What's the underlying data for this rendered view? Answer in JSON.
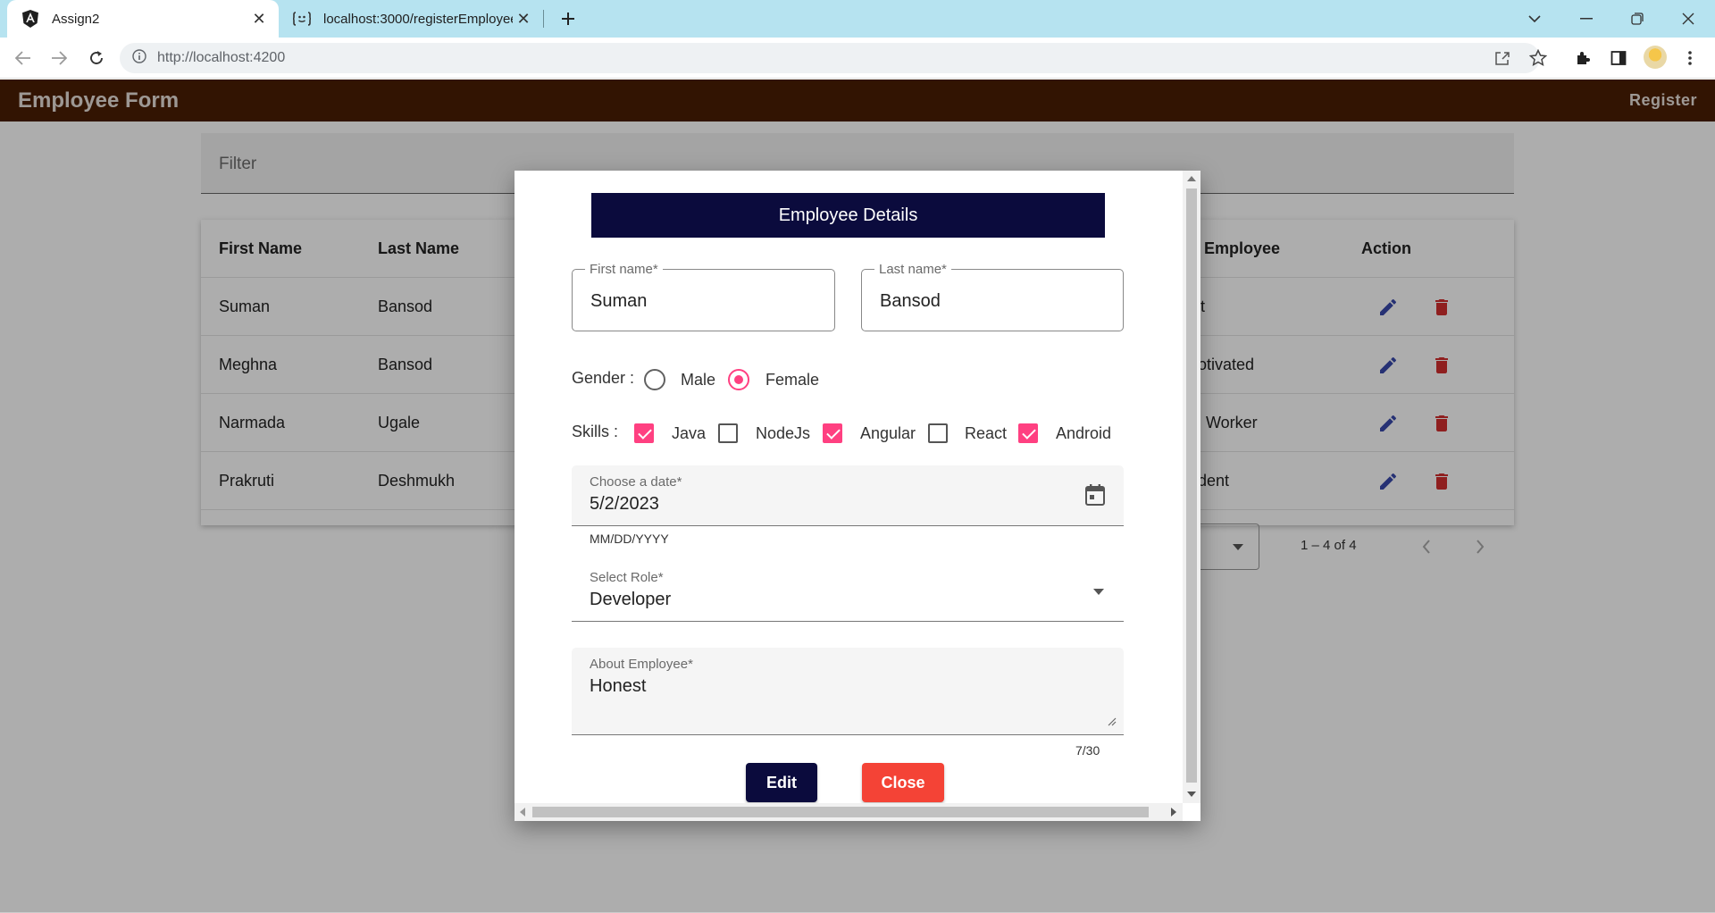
{
  "browser": {
    "tabs": [
      {
        "title": "Assign2",
        "icon": "angular-icon",
        "active": true
      },
      {
        "title": "localhost:3000/registerEmployee",
        "icon": "json-server-icon",
        "active": false
      }
    ],
    "url": "http://localhost:4200"
  },
  "app": {
    "title": "Employee Form",
    "register_label": "Register"
  },
  "filter": {
    "placeholder": "Filter"
  },
  "table": {
    "headers": [
      "First Name",
      "Last Name",
      "Employee",
      "Action"
    ],
    "rows": [
      {
        "first": "Suman",
        "last": "Bansod",
        "about_partial": "st"
      },
      {
        "first": "Meghna",
        "last": "Bansod",
        "about_partial": "lotivated"
      },
      {
        "first": "Narmada",
        "last": "Ugale",
        "about_partial": "Worker"
      },
      {
        "first": "Prakruti",
        "last": "Deshmukh",
        "about_partial": "dent"
      }
    ],
    "paginator_range": "1 – 4 of 4"
  },
  "dialog": {
    "title": "Employee Details",
    "first_name": {
      "label": "First name*",
      "value": "Suman"
    },
    "last_name": {
      "label": "Last name*",
      "value": "Bansod"
    },
    "gender": {
      "label": "Gender :",
      "options": [
        "Male",
        "Female"
      ],
      "selected": "Female"
    },
    "skills": {
      "label": "Skills :",
      "options": [
        {
          "name": "Java",
          "checked": true
        },
        {
          "name": "NodeJs",
          "checked": false
        },
        {
          "name": "Angular",
          "checked": true
        },
        {
          "name": "React",
          "checked": false
        },
        {
          "name": "Android",
          "checked": true
        }
      ]
    },
    "date": {
      "label": "Choose a date*",
      "value": "5/2/2023",
      "hint": "MM/DD/YYYY"
    },
    "role": {
      "label": "Select Role*",
      "value": "Developer"
    },
    "about": {
      "label": "About Employee*",
      "value": "Honest",
      "counter": "7/30"
    },
    "edit_label": "Edit",
    "close_label": "Close"
  },
  "colors": {
    "toolbar": "#4b1e04",
    "dialog_header": "#0b0b3d",
    "accent_pink": "#ff4081",
    "close_red": "#f44336",
    "edit_blue": "#3949ab",
    "delete_red": "#d32f2f"
  }
}
